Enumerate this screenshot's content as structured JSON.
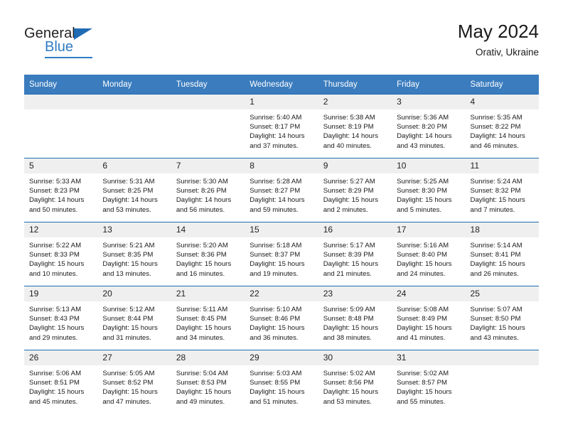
{
  "brand": {
    "name_top": "General",
    "name_bottom": "Blue",
    "triangle_icon": "triangle-icon",
    "accent_color": "#2e7cc4",
    "dark_color": "#231f20"
  },
  "header": {
    "title": "May 2024",
    "subtitle": "Orativ, Ukraine"
  },
  "theme": {
    "header_blue": "#3a7cbe",
    "rule_blue": "#1f6cb4",
    "daynum_gray": "#efefef"
  },
  "weekday_headers": [
    "Sunday",
    "Monday",
    "Tuesday",
    "Wednesday",
    "Thursday",
    "Friday",
    "Saturday"
  ],
  "weeks": [
    [
      {
        "day": "",
        "lines": []
      },
      {
        "day": "",
        "lines": []
      },
      {
        "day": "",
        "lines": []
      },
      {
        "day": "1",
        "lines": [
          "Sunrise: 5:40 AM",
          "Sunset: 8:17 PM",
          "Daylight: 14 hours",
          "and 37 minutes."
        ]
      },
      {
        "day": "2",
        "lines": [
          "Sunrise: 5:38 AM",
          "Sunset: 8:19 PM",
          "Daylight: 14 hours",
          "and 40 minutes."
        ]
      },
      {
        "day": "3",
        "lines": [
          "Sunrise: 5:36 AM",
          "Sunset: 8:20 PM",
          "Daylight: 14 hours",
          "and 43 minutes."
        ]
      },
      {
        "day": "4",
        "lines": [
          "Sunrise: 5:35 AM",
          "Sunset: 8:22 PM",
          "Daylight: 14 hours",
          "and 46 minutes."
        ]
      }
    ],
    [
      {
        "day": "5",
        "lines": [
          "Sunrise: 5:33 AM",
          "Sunset: 8:23 PM",
          "Daylight: 14 hours",
          "and 50 minutes."
        ]
      },
      {
        "day": "6",
        "lines": [
          "Sunrise: 5:31 AM",
          "Sunset: 8:25 PM",
          "Daylight: 14 hours",
          "and 53 minutes."
        ]
      },
      {
        "day": "7",
        "lines": [
          "Sunrise: 5:30 AM",
          "Sunset: 8:26 PM",
          "Daylight: 14 hours",
          "and 56 minutes."
        ]
      },
      {
        "day": "8",
        "lines": [
          "Sunrise: 5:28 AM",
          "Sunset: 8:27 PM",
          "Daylight: 14 hours",
          "and 59 minutes."
        ]
      },
      {
        "day": "9",
        "lines": [
          "Sunrise: 5:27 AM",
          "Sunset: 8:29 PM",
          "Daylight: 15 hours",
          "and 2 minutes."
        ]
      },
      {
        "day": "10",
        "lines": [
          "Sunrise: 5:25 AM",
          "Sunset: 8:30 PM",
          "Daylight: 15 hours",
          "and 5 minutes."
        ]
      },
      {
        "day": "11",
        "lines": [
          "Sunrise: 5:24 AM",
          "Sunset: 8:32 PM",
          "Daylight: 15 hours",
          "and 7 minutes."
        ]
      }
    ],
    [
      {
        "day": "12",
        "lines": [
          "Sunrise: 5:22 AM",
          "Sunset: 8:33 PM",
          "Daylight: 15 hours",
          "and 10 minutes."
        ]
      },
      {
        "day": "13",
        "lines": [
          "Sunrise: 5:21 AM",
          "Sunset: 8:35 PM",
          "Daylight: 15 hours",
          "and 13 minutes."
        ]
      },
      {
        "day": "14",
        "lines": [
          "Sunrise: 5:20 AM",
          "Sunset: 8:36 PM",
          "Daylight: 15 hours",
          "and 16 minutes."
        ]
      },
      {
        "day": "15",
        "lines": [
          "Sunrise: 5:18 AM",
          "Sunset: 8:37 PM",
          "Daylight: 15 hours",
          "and 19 minutes."
        ]
      },
      {
        "day": "16",
        "lines": [
          "Sunrise: 5:17 AM",
          "Sunset: 8:39 PM",
          "Daylight: 15 hours",
          "and 21 minutes."
        ]
      },
      {
        "day": "17",
        "lines": [
          "Sunrise: 5:16 AM",
          "Sunset: 8:40 PM",
          "Daylight: 15 hours",
          "and 24 minutes."
        ]
      },
      {
        "day": "18",
        "lines": [
          "Sunrise: 5:14 AM",
          "Sunset: 8:41 PM",
          "Daylight: 15 hours",
          "and 26 minutes."
        ]
      }
    ],
    [
      {
        "day": "19",
        "lines": [
          "Sunrise: 5:13 AM",
          "Sunset: 8:43 PM",
          "Daylight: 15 hours",
          "and 29 minutes."
        ]
      },
      {
        "day": "20",
        "lines": [
          "Sunrise: 5:12 AM",
          "Sunset: 8:44 PM",
          "Daylight: 15 hours",
          "and 31 minutes."
        ]
      },
      {
        "day": "21",
        "lines": [
          "Sunrise: 5:11 AM",
          "Sunset: 8:45 PM",
          "Daylight: 15 hours",
          "and 34 minutes."
        ]
      },
      {
        "day": "22",
        "lines": [
          "Sunrise: 5:10 AM",
          "Sunset: 8:46 PM",
          "Daylight: 15 hours",
          "and 36 minutes."
        ]
      },
      {
        "day": "23",
        "lines": [
          "Sunrise: 5:09 AM",
          "Sunset: 8:48 PM",
          "Daylight: 15 hours",
          "and 38 minutes."
        ]
      },
      {
        "day": "24",
        "lines": [
          "Sunrise: 5:08 AM",
          "Sunset: 8:49 PM",
          "Daylight: 15 hours",
          "and 41 minutes."
        ]
      },
      {
        "day": "25",
        "lines": [
          "Sunrise: 5:07 AM",
          "Sunset: 8:50 PM",
          "Daylight: 15 hours",
          "and 43 minutes."
        ]
      }
    ],
    [
      {
        "day": "26",
        "lines": [
          "Sunrise: 5:06 AM",
          "Sunset: 8:51 PM",
          "Daylight: 15 hours",
          "and 45 minutes."
        ]
      },
      {
        "day": "27",
        "lines": [
          "Sunrise: 5:05 AM",
          "Sunset: 8:52 PM",
          "Daylight: 15 hours",
          "and 47 minutes."
        ]
      },
      {
        "day": "28",
        "lines": [
          "Sunrise: 5:04 AM",
          "Sunset: 8:53 PM",
          "Daylight: 15 hours",
          "and 49 minutes."
        ]
      },
      {
        "day": "29",
        "lines": [
          "Sunrise: 5:03 AM",
          "Sunset: 8:55 PM",
          "Daylight: 15 hours",
          "and 51 minutes."
        ]
      },
      {
        "day": "30",
        "lines": [
          "Sunrise: 5:02 AM",
          "Sunset: 8:56 PM",
          "Daylight: 15 hours",
          "and 53 minutes."
        ]
      },
      {
        "day": "31",
        "lines": [
          "Sunrise: 5:02 AM",
          "Sunset: 8:57 PM",
          "Daylight: 15 hours",
          "and 55 minutes."
        ]
      },
      {
        "day": "",
        "lines": []
      }
    ]
  ]
}
